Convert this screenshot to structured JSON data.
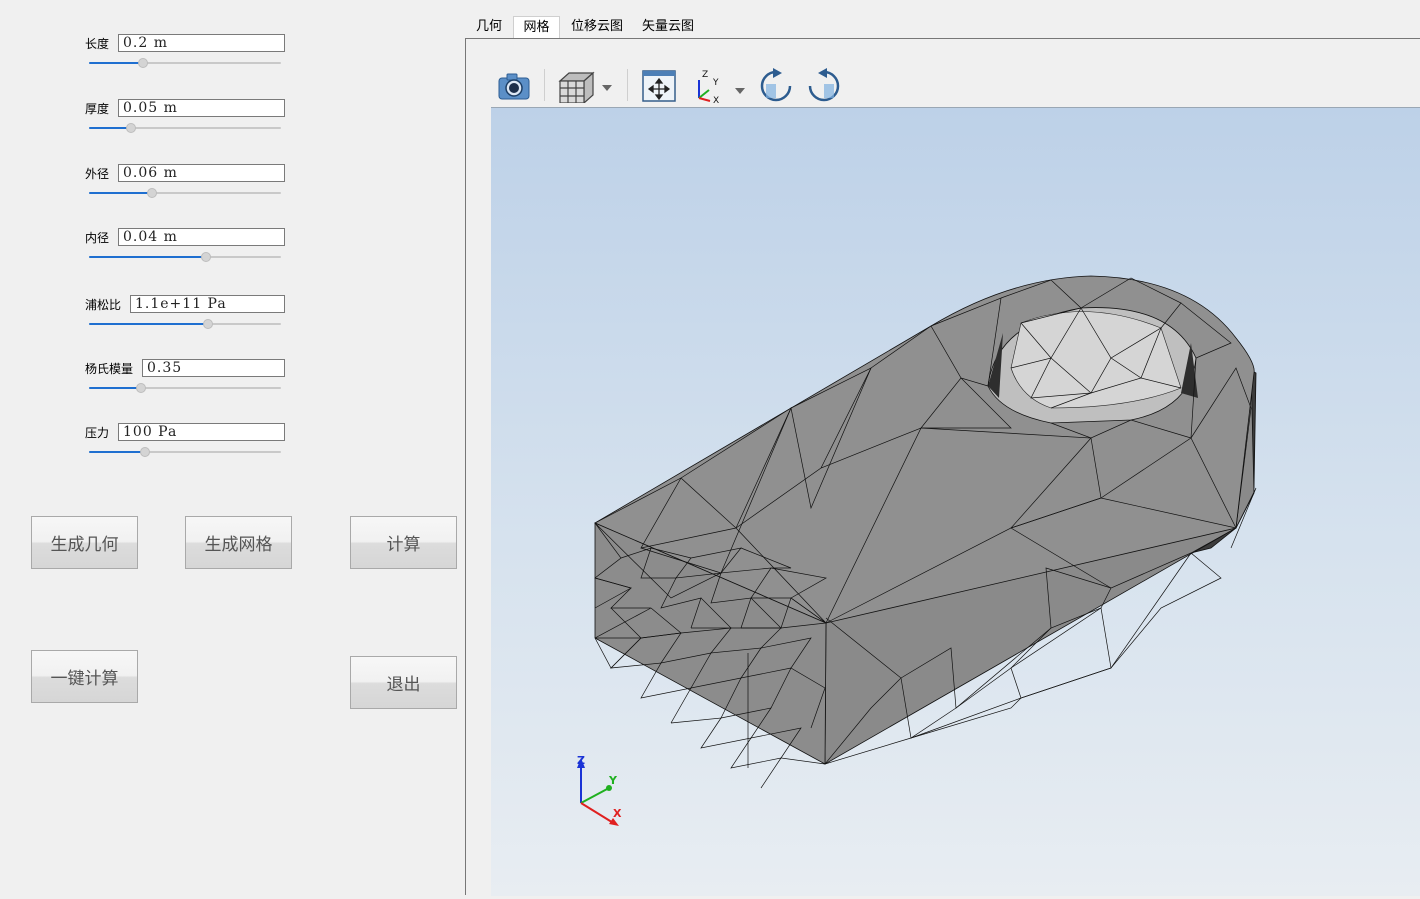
{
  "tabs": [
    {
      "label": "几何"
    },
    {
      "label": "网格"
    },
    {
      "label": "位移云图"
    },
    {
      "label": "矢量云图"
    }
  ],
  "active_tab": "网格",
  "params": [
    {
      "label": "长度",
      "value": "0.2 m",
      "slider_fraction": 0.28
    },
    {
      "label": "厚度",
      "value": "0.05 m",
      "slider_fraction": 0.22
    },
    {
      "label": "外径",
      "value": "0.06 m",
      "slider_fraction": 0.33
    },
    {
      "label": "内径",
      "value": "0.04 m",
      "slider_fraction": 0.61
    },
    {
      "label": "浦松比",
      "value": "1.1e+11 Pa",
      "slider_fraction": 0.62
    },
    {
      "label": "杨氏模量",
      "value": "0.35",
      "slider_fraction": 0.27
    },
    {
      "label": "压力",
      "value": "100 Pa",
      "slider_fraction": 0.29
    }
  ],
  "buttons": {
    "gen_geometry": "生成几何",
    "gen_mesh": "生成网格",
    "compute": "计算",
    "one_click": "一键计算",
    "exit": "退出"
  },
  "toolbar": {
    "icons": [
      "camera-icon",
      "cube-view-icon",
      "fit-all-icon",
      "axes-view-icon",
      "rotate-cw-icon",
      "rotate-ccw-icon"
    ]
  },
  "triad": {
    "z": "Z",
    "y": "Y",
    "x": "X",
    "x_color": "#e02020",
    "y_color": "#20b020",
    "z_color": "#1a33d6"
  },
  "colors": {
    "slider_fill": "#1f6fd0",
    "mesh_face": "#8e8e8e",
    "mesh_edge": "#111111"
  }
}
